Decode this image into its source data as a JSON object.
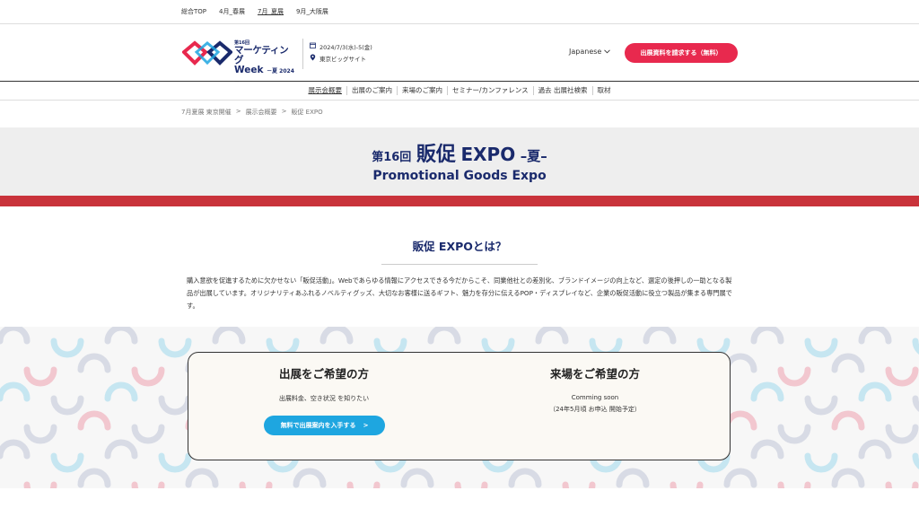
{
  "topnav": {
    "links": [
      "総合TOP",
      "4月_春展",
      "7月_夏展",
      "9月_大阪展"
    ],
    "active_index": 2
  },
  "header": {
    "logo": {
      "edition": "第16回",
      "title_line1": "マーケティング",
      "title_line2": "Week",
      "title_sub": "－夏 2024－"
    },
    "date": "2024/7/3(水)-5(金)",
    "venue": "東京ビッグサイト",
    "language": "Japanese",
    "cta_label": "出展資料を請求する（無料）"
  },
  "mainnav": {
    "items": [
      "展示会概要",
      "出展のご案内",
      "来場のご案内",
      "セミナー/カンファレンス",
      "過去 出展社検索",
      "取材"
    ],
    "current_index": 0
  },
  "breadcrumb": [
    "7月夏展 東京開催",
    ">",
    "展示会概要",
    ">",
    "販促 EXPO"
  ],
  "hero": {
    "edition": "第16回",
    "title_jp": "販促",
    "title_en": "EXPO",
    "season": "–夏–",
    "subtitle": "Promotional Goods Expo"
  },
  "about": {
    "title": "販促 EXPOとは？",
    "text": "購入意欲を促進するために欠かせない「販促活動」。Webであらゆる情報にアクセスできる今だからこそ、同業他社との差別化、ブランドイメージの向上など、選定の後押しの一助となる製品が出展しています。オリジナリティあふれるノベルティグッズ、大切なお客様に送るギフト、魅力を存分に伝えるPOP・ディスプレイなど、企業の販促活動に役立つ製品が集まる専門展です。"
  },
  "exhibit": {
    "title": "出展をご希望の方",
    "desc": "出展料金、空き状況 を知りたい",
    "cta_label": "無料で出展案内を入手する",
    "cta_arrow": ">"
  },
  "visit": {
    "title": "来場をご希望の方",
    "desc1": "Comming soon",
    "desc2": "（24年5月頃 お申込 開始予定）"
  },
  "colors": {
    "navy": "#1a2a6c",
    "red_cta": "#e8294e",
    "hero_bar": "#c9333b",
    "blue_cta": "#1ea6e0",
    "pattern_pink": "#f2c7cf",
    "pattern_blue": "#c6e6f1",
    "pattern_gray": "#d8dbe5"
  },
  "icons": {
    "calendar": "calendar-icon",
    "location": "location-pin-icon",
    "chevron": "chevron-down-icon"
  }
}
